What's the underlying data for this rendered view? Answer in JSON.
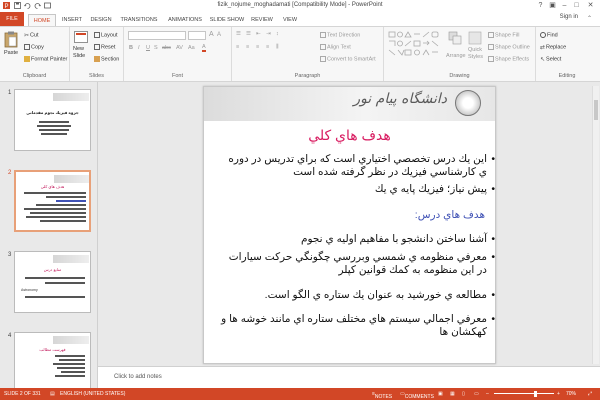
{
  "window": {
    "title": "fizik_nojume_moghadamati [Compatibility Mode] - PowerPoint",
    "sign_in": "Sign in",
    "help": "?"
  },
  "tabs": [
    "FILE",
    "HOME",
    "INSERT",
    "DESIGN",
    "TRANSITIONS",
    "ANIMATIONS",
    "SLIDE SHOW",
    "REVIEW",
    "VIEW"
  ],
  "active_tab": "HOME",
  "ribbon": {
    "clipboard": {
      "paste": "Paste",
      "cut": "Cut",
      "copy": "Copy",
      "format_painter": "Format Painter",
      "label": "Clipboard"
    },
    "slides": {
      "new_slide": "New Slide",
      "layout": "Layout",
      "reset": "Reset",
      "section": "Section",
      "label": "Slides"
    },
    "font": {
      "label": "Font"
    },
    "paragraph": {
      "text_direction": "Text Direction",
      "align_text": "Align Text",
      "convert_smartart": "Convert to SmartArt",
      "label": "Paragraph"
    },
    "drawing": {
      "arrange": "Arrange",
      "quick_styles": "Quick Styles",
      "shape_fill": "Shape Fill",
      "shape_outline": "Shape Outline",
      "shape_effects": "Shape Effects",
      "label": "Drawing"
    },
    "editing": {
      "find": "Find",
      "replace": "Replace",
      "select": "Select",
      "label": "Editing"
    }
  },
  "thumbnails": [
    {
      "num": "1",
      "title": "جزوه فيزيك نجوم مقدماتي"
    },
    {
      "num": "2",
      "title": "هدف هاي كلي"
    },
    {
      "num": "3",
      "title": "منابع درس",
      "latin": "Astronomy"
    },
    {
      "num": "4",
      "title": "فهرست مطالب"
    }
  ],
  "slide": {
    "logo_text": "دانشگاه پيام نور",
    "heading": "هدف هاي كلي",
    "bullets_top": [
      "اين يك درس تخصصي اختياري  است كه براي تدريس در دوره ي كارشناسي فيزيك در نظر گرفته شده است",
      "پيش نياز؛ فيزيك پايه ي يك"
    ],
    "subheading": "هدف هاي درس:",
    "bullets_bottom": [
      "آشنا ساختن دانشجو با مفاهيم اوليه ي نجوم",
      "معرفي منظومه ي شمسي وبررسي چگونگي حركت سيارات در اين منظومه به كمك قوانين كپلر",
      "مطالعه ي خورشيد به عنوان يك ستاره ي الگو است.",
      "معرفي اجمالي سيستم هاي مختلف ستاره اي مانند خوشه ها و كهكشان ها"
    ]
  },
  "notes_placeholder": "Click to add notes",
  "status": {
    "slide_info": "SLIDE 2 OF 331",
    "language": "ENGLISH (UNITED STATES)",
    "notes": "NOTES",
    "comments": "COMMENTS",
    "zoom": "70%"
  },
  "colors": {
    "accent": "#d24726",
    "heading_pink": "#d81b60",
    "subheading_blue": "#3f51b5"
  }
}
